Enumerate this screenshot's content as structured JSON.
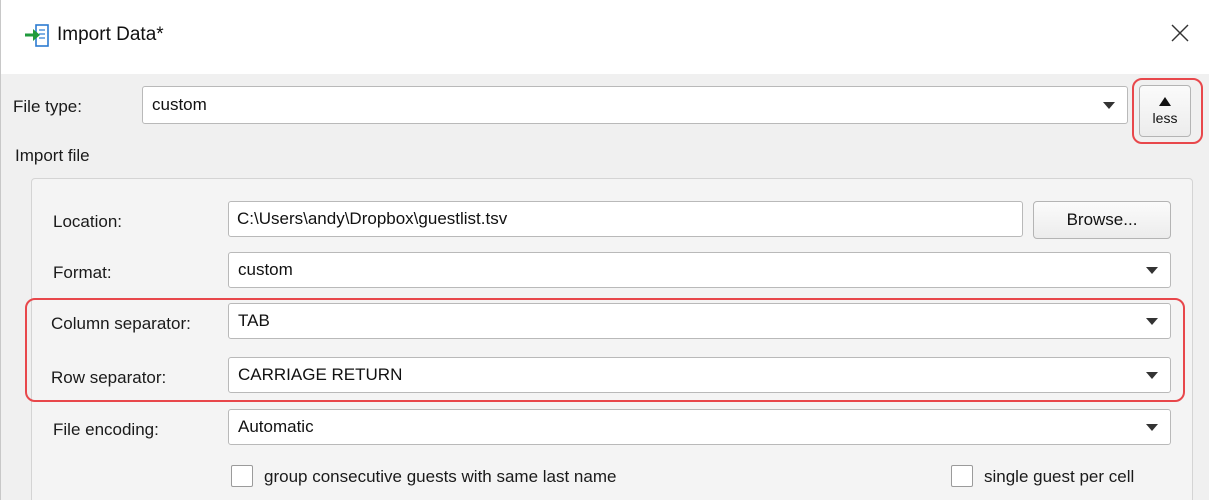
{
  "window": {
    "title": "Import Data*",
    "close_icon": "close-x-icon",
    "import_icon": "import-arrow-icon"
  },
  "file_type": {
    "label": "File type:",
    "value": "custom",
    "less_button_label": "less"
  },
  "import_file": {
    "section_label": "Import file",
    "location_label": "Location:",
    "location_value": "C:\\Users\\andy\\Dropbox\\guestlist.tsv",
    "browse_label": "Browse...",
    "format_label": "Format:",
    "format_value": "custom",
    "column_separator_label": "Column separator:",
    "column_separator_value": "TAB",
    "row_separator_label": "Row separator:",
    "row_separator_value": "CARRIAGE RETURN",
    "encoding_label": "File encoding:",
    "encoding_value": "Automatic",
    "group_guests_label": "group consecutive guests with same last name",
    "single_guest_label": "single guest per cell"
  },
  "colors": {
    "highlight": "#e8474b",
    "icon_green": "#1f9a3c",
    "icon_blue": "#2c7bd1"
  }
}
